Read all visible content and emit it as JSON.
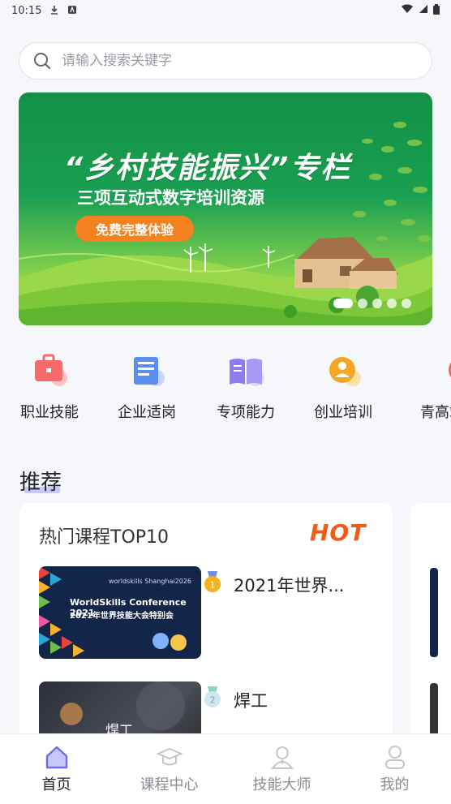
{
  "status_bar": {
    "time": "10:15",
    "left_icons": [
      "download-icon",
      "app-notification-icon"
    ],
    "right_icons": [
      "wifi-icon",
      "signal-icon",
      "battery-icon"
    ]
  },
  "search": {
    "placeholder": "请输入搜索关键字"
  },
  "banner": {
    "title": "“乡村技能振兴”专栏",
    "subtitle": "三项互动式数字培训资源",
    "button_label": "免费完整体验",
    "carousel": {
      "count": 5,
      "active_index": 0
    }
  },
  "categories": [
    {
      "label": "职业技能",
      "icon": "briefcase-icon",
      "color": "#f56a6a"
    },
    {
      "label": "企业适岗",
      "icon": "document-icon",
      "color": "#5b8ef0"
    },
    {
      "label": "专项能力",
      "icon": "book-icon",
      "color": "#8f7cf0"
    },
    {
      "label": "创业培训",
      "icon": "person-badge-icon",
      "color": "#f5a623"
    },
    {
      "label": "青高端",
      "icon": "tag-icon",
      "color": "#f56a4a"
    }
  ],
  "recommend": {
    "section_title": "推荐",
    "card": {
      "title": "热门课程TOP10",
      "badge": "HOT",
      "courses": [
        {
          "rank": "1",
          "name": "2021年世界...",
          "thumb_title": "WorldSkills Conference 2021",
          "thumb_subtitle": "2021年世界技能大会特别会",
          "thumb_brand": "worldskills Shanghai2026"
        },
        {
          "rank": "2",
          "name": "焊工",
          "thumb_title": "焊工"
        }
      ]
    }
  },
  "tabbar": [
    {
      "label": "首页",
      "icon": "home-icon",
      "active": true
    },
    {
      "label": "课程中心",
      "icon": "graduation-cap-icon",
      "active": false
    },
    {
      "label": "技能大师",
      "icon": "master-icon",
      "active": false
    },
    {
      "label": "我的",
      "icon": "user-icon",
      "active": false
    }
  ],
  "colors": {
    "accent": "#6c6cf5",
    "hot": "#f25a1a",
    "banner_green": "#1aa052",
    "banner_button": "#f58220"
  }
}
